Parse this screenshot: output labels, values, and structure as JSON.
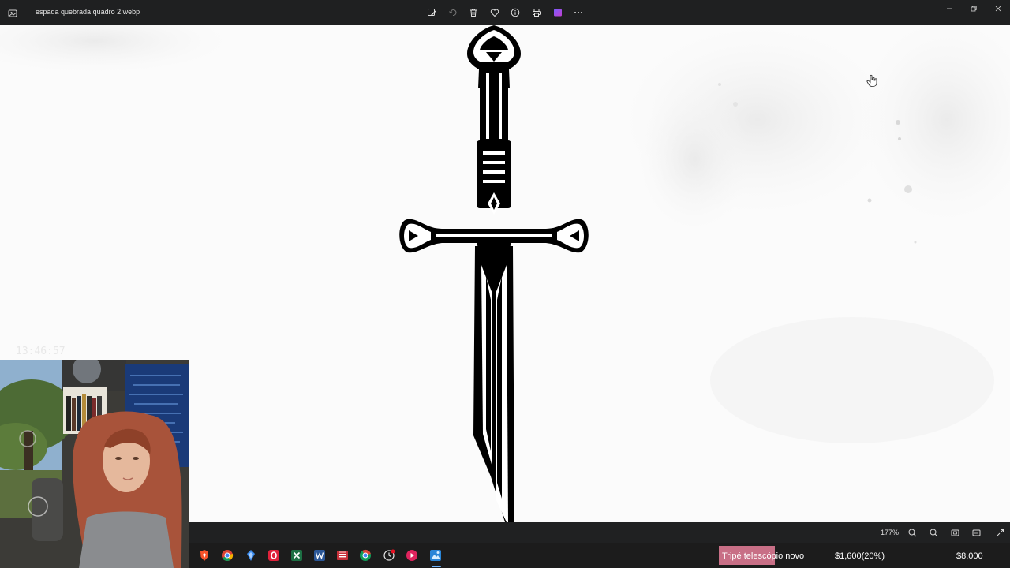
{
  "window": {
    "file_name": "espada quebrada quadro 2.webp",
    "toolbar_icons": [
      "edit-image-icon",
      "rotate-icon",
      "delete-icon",
      "favorite-icon",
      "info-icon",
      "print-icon",
      "clipchamp-icon",
      "more-icon"
    ],
    "controls": [
      "minimize-icon",
      "maximize-icon",
      "close-icon"
    ]
  },
  "viewer": {
    "zoom_level": "177%",
    "zoom_controls": [
      "zoom-out-icon",
      "zoom-in-icon",
      "fit-to-window-icon",
      "actual-size-icon",
      "fullscreen-icon"
    ]
  },
  "overlay": {
    "clock_text": "13:46:57"
  },
  "taskbar": {
    "apps": [
      "brave-icon",
      "chrome-icon",
      "app-icon-blue",
      "opera-icon",
      "excel-icon",
      "word-icon",
      "calendar-app-icon",
      "chrome-alt-icon",
      "clock-app-icon",
      "media-player-icon",
      "photos-icon"
    ],
    "active_app": "photos-icon"
  },
  "goal_widget": {
    "label": "Tripé telescópio novo",
    "current": "$1,600(20%)",
    "target": "$8,000",
    "progress_fraction": 0.2
  },
  "colors": {
    "titlebar_bg": "#1f2021",
    "taskbar_bg": "#1c1c1c",
    "goal_fill": "#c86f86",
    "accent": "#6fb5ff"
  }
}
